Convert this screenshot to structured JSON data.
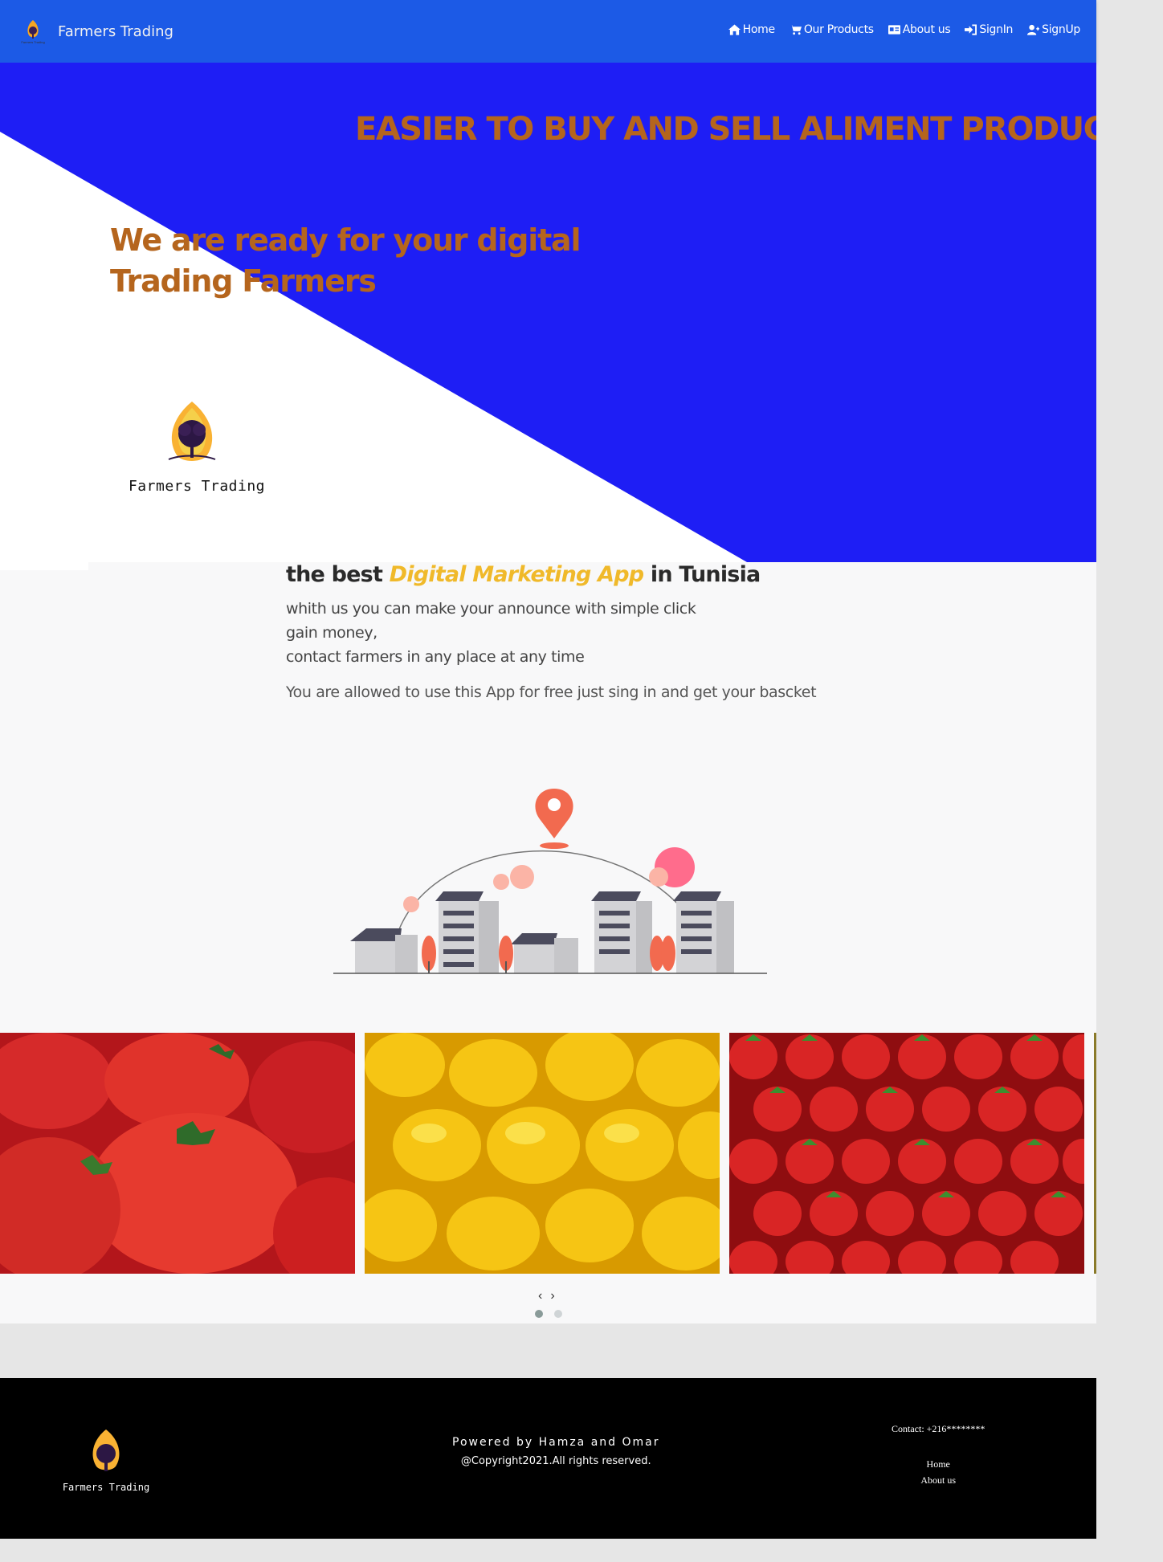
{
  "navbar": {
    "brand": "Farmers Trading",
    "items": [
      {
        "label": "Home",
        "icon": "home-icon"
      },
      {
        "label": "Our Products",
        "icon": "cart-icon"
      },
      {
        "label": "About us",
        "icon": "id-card-icon"
      },
      {
        "label": "SignIn",
        "icon": "sign-in-icon"
      },
      {
        "label": "SignUp",
        "icon": "user-plus-icon"
      }
    ],
    "bg_color": "#1c5ae6"
  },
  "hero": {
    "title": "EASIER TO BUY AND SELL ALIMENT PRODUCTS",
    "subtitle_line1": "We are ready for your digital",
    "subtitle_line2": "Trading Farmers",
    "logo_text": "Farmers Trading",
    "bg_color": "#1e1ef5",
    "accent_color": "#b5651d"
  },
  "intro": {
    "heading_prefix": "the best ",
    "heading_highlight": "Digital Marketing App",
    "heading_suffix": " in Tunisia",
    "line1": "whith us you can make your announce with simple click",
    "line2": "gain money,",
    "line3": "contact farmers in any place at any time",
    "free_text": "You are allowed to use this App for free just sing in and get your bascket"
  },
  "carousel": {
    "slides": [
      "tomatoes",
      "lemons",
      "strawberries"
    ],
    "prev": "‹",
    "next": "›",
    "dots": 2,
    "active_dot": 1
  },
  "footer": {
    "logo_text": "Farmers Trading",
    "powered": "Powered by Hamza and Omar",
    "copyright": "@Copyright2021.All rights reserved.",
    "contact": "Contact: +216********",
    "links": [
      "Home",
      "About us"
    ]
  }
}
